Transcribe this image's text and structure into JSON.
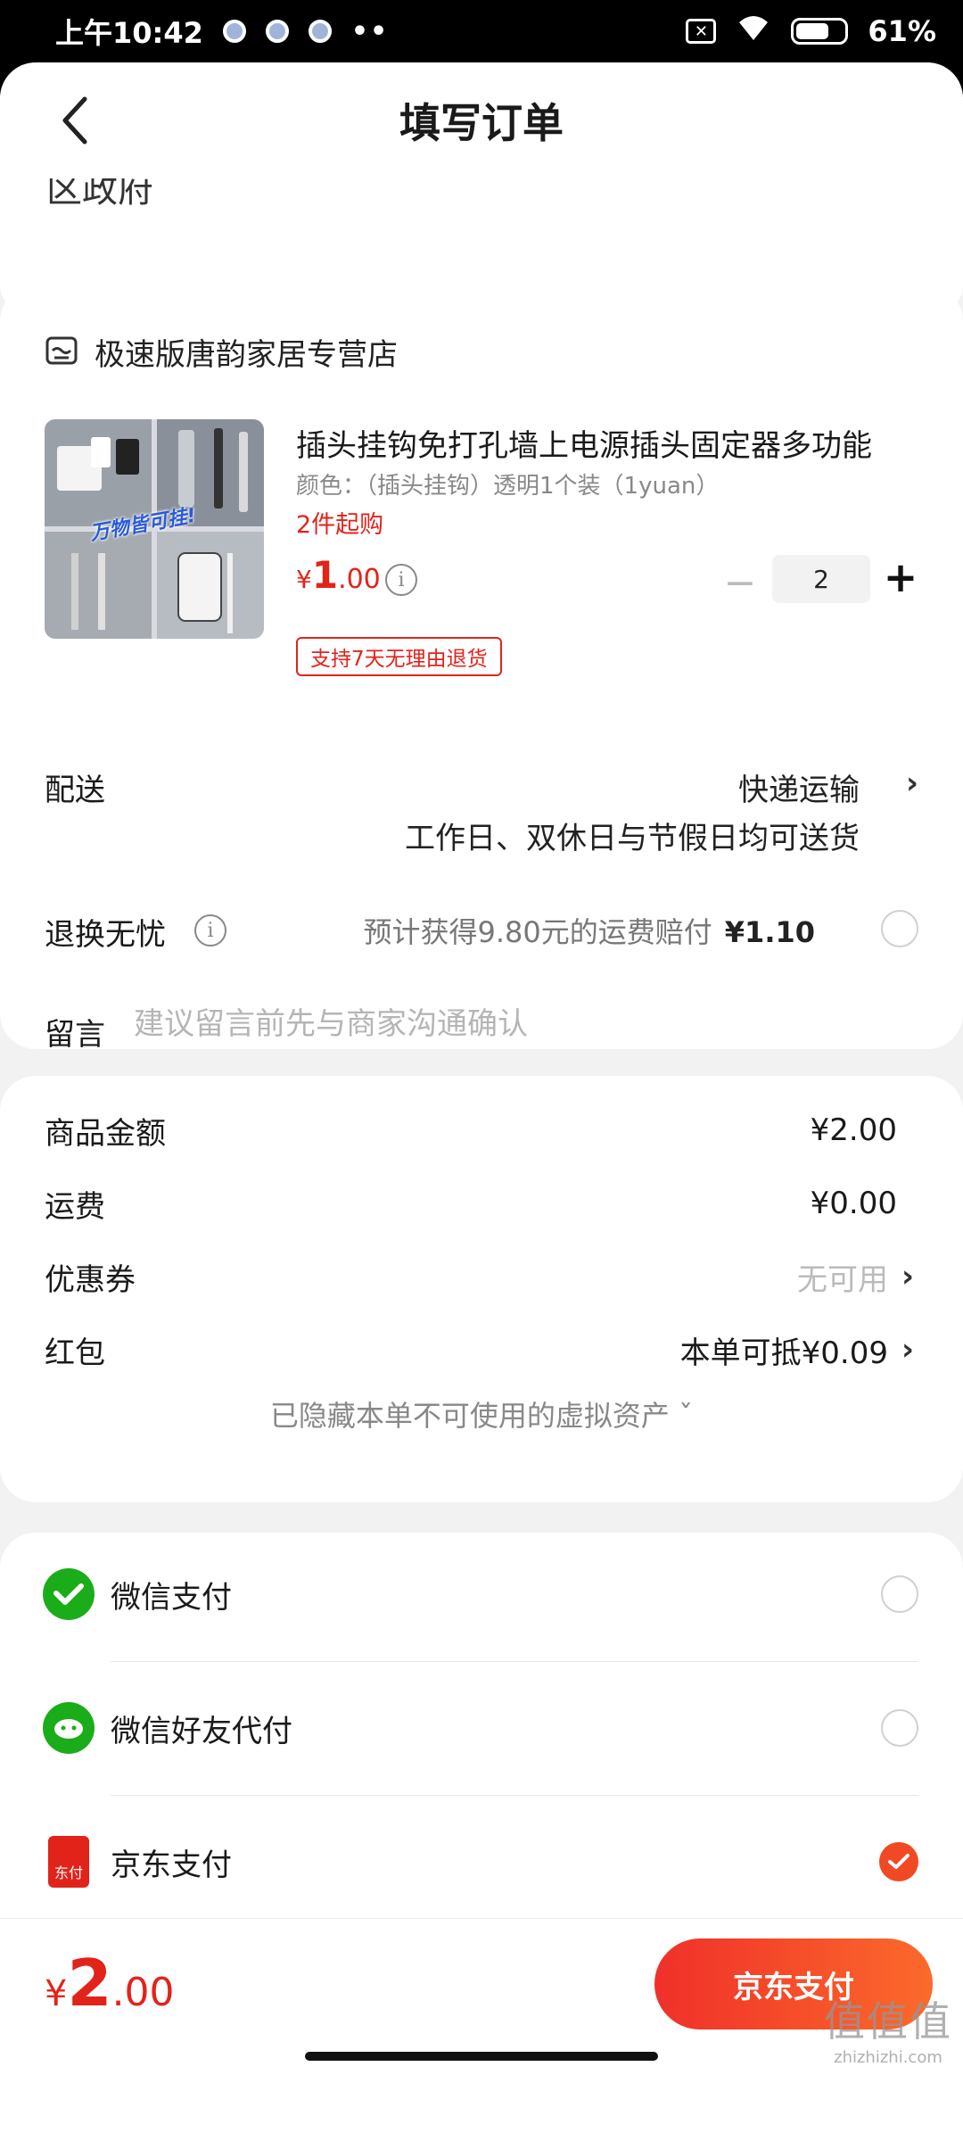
{
  "status_bar": {
    "time": "上午10:42",
    "more": "••",
    "battery": "61%"
  },
  "header": {
    "title": "填写订单"
  },
  "address": {
    "partial_text": "区政府"
  },
  "shop": {
    "name": "极速版唐韵家居专营店",
    "product": {
      "title": "插头挂钩免打孔墙上电源插头固定器多功能",
      "spec": "颜色：（插头挂钩）透明1个装（1yuan）",
      "min_purchase": "2件起购",
      "price_symbol": "¥",
      "price_int": "1",
      "price_dec": ".00",
      "image_caption": "万物皆可挂!",
      "quantity": "2",
      "return_tag": "支持7天无理由退货"
    },
    "delivery": {
      "label": "配送",
      "method": "快递运输",
      "note": "工作日、双休日与节假日均可送货"
    },
    "exchange": {
      "label": "退换无忧",
      "desc": "预计获得9.80元的运费赔付",
      "price": "¥1.10"
    },
    "message": {
      "label": "留言",
      "placeholder": "建议留言前先与商家沟通确认"
    }
  },
  "summary": {
    "goods_label": "商品金额",
    "goods_value": "¥2.00",
    "shipping_label": "运费",
    "shipping_value": "¥0.00",
    "coupon_label": "优惠券",
    "coupon_value": "无可用",
    "redpacket_label": "红包",
    "redpacket_value": "本单可抵¥0.09",
    "hidden_assets": "已隐藏本单不可使用的虚拟资产 ˇ"
  },
  "payment": {
    "options": [
      {
        "label": "微信支付",
        "icon": "wechat-pay-icon",
        "selected": false
      },
      {
        "label": "微信好友代付",
        "icon": "wechat-friend-pay-icon",
        "selected": false
      },
      {
        "label": "京东支付",
        "icon": "jd-pay-icon",
        "selected": true
      }
    ],
    "jd_icon_text": "东付"
  },
  "footer": {
    "total_symbol": "¥",
    "total_int": "2",
    "total_dec": ".00",
    "pay_button": "京东支付"
  },
  "watermark": {
    "glyph": "值值值",
    "url": "zhizhizhi.com"
  },
  "colors": {
    "accent_red": "#e2231a",
    "button_gradient_start": "#f0302a",
    "button_gradient_end": "#fb6a2b",
    "wechat_green": "#1aad19"
  }
}
